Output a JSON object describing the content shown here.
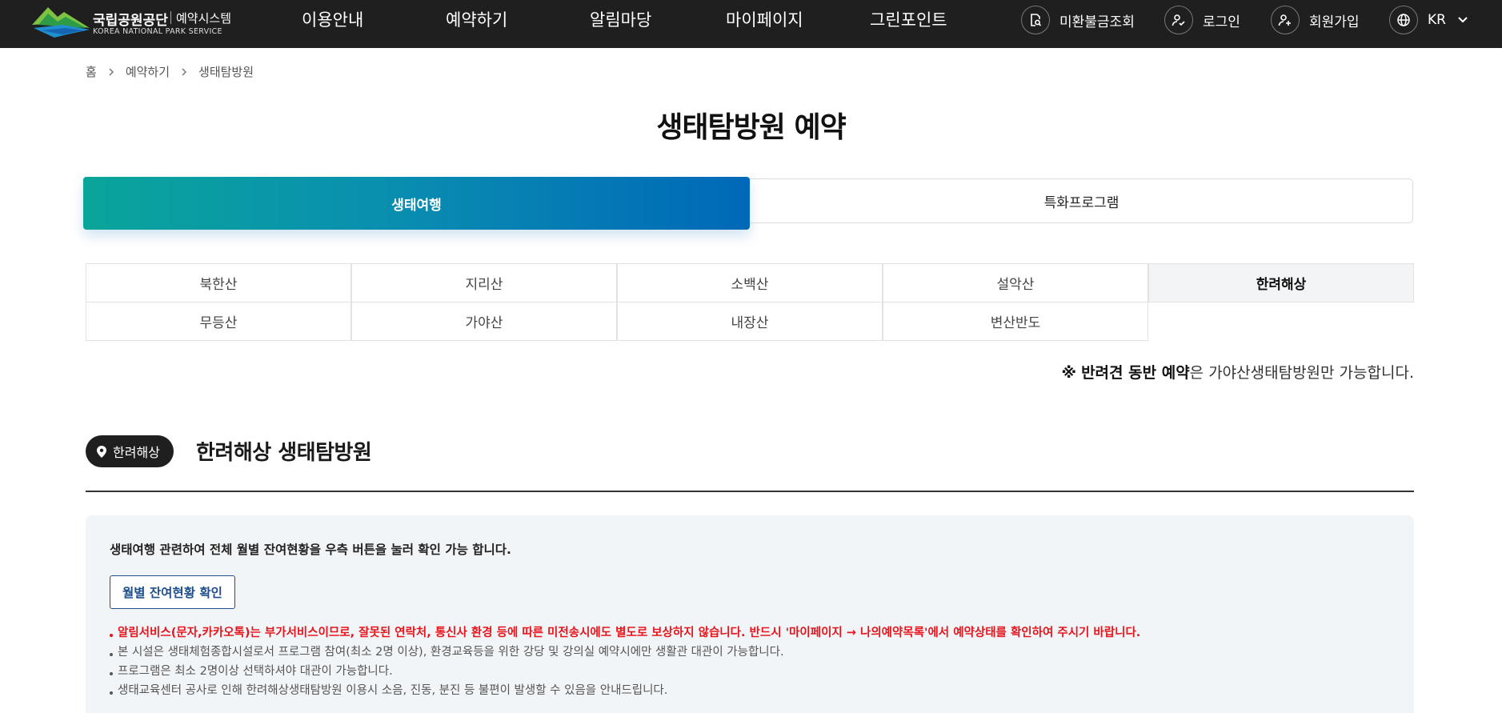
{
  "header": {
    "logo": {
      "name_ko": "국립공원공단",
      "system": "예약시스템",
      "name_en": "KOREA NATIONAL PARK SERVICE"
    },
    "nav": [
      "이용안내",
      "예약하기",
      "알림마당",
      "마이페이지",
      "그린포인트"
    ],
    "utils": {
      "refund": "미환불금조회",
      "login": "로그인",
      "signup": "회원가입",
      "language": "KR"
    }
  },
  "breadcrumb": [
    "홈",
    "예약하기",
    "생태탐방원"
  ],
  "page_title": "생태탐방원 예약",
  "segment_tabs": {
    "active": "생태여행",
    "inactive": "특화프로그램"
  },
  "parks": {
    "row1": [
      "북한산",
      "지리산",
      "소백산",
      "설악산",
      "한려해상"
    ],
    "row2": [
      "무등산",
      "가야산",
      "내장산",
      "변산반도"
    ],
    "selected": "한려해상"
  },
  "pet_notice": {
    "mark": "※",
    "bold": "반려견 동반 예약",
    "rest": "은 가야산생태탐방원만 가능합니다."
  },
  "section": {
    "badge": "한려해상",
    "title": "한려해상 생태탐방원"
  },
  "info": {
    "lead": "생태여행 관련하여 전체 월별 잔여현황을 우측 버튼을 눌러 확인 가능 합니다.",
    "monthly_button": "월별 잔여현황 확인",
    "notes": [
      "알림서비스(문자,카카오톡)는 부가서비스이므로, 잘못된 연락처, 통신사 환경 등에 따른 미전송시에도 별도로 보상하지 않습니다. 반드시 '마이페이지 → 나의예약목록'에서 예약상태를 확인하여 주시기 바랍니다.",
      "본 시설은 생태체험종합시설로서 프로그램 참여(최소 2명 이상), 환경교육등을 위한 강당 및 강의실 예약시에만 생활관 대관이 가능합니다.",
      "프로그램은 최소 2명이상 선택하셔야 대관이 가능합니다.",
      "생태교육센터 공사로 인해 한려해상생태탐방원 이용시 소음, 진동, 분진 등 불편이 발생할 수 있음을 안내드립니다."
    ]
  },
  "colors": {
    "header_bg": "#1f1f1f",
    "tab_gradient_start": "#0aa59a",
    "tab_gradient_end": "#0068b8",
    "warning_red": "#e8141b",
    "button_blue": "#1f4e8c"
  },
  "icons": [
    "search-document-icon",
    "user-login-icon",
    "user-add-icon",
    "globe-icon",
    "chevron-down-icon",
    "chevron-right-icon",
    "location-pin-icon"
  ]
}
